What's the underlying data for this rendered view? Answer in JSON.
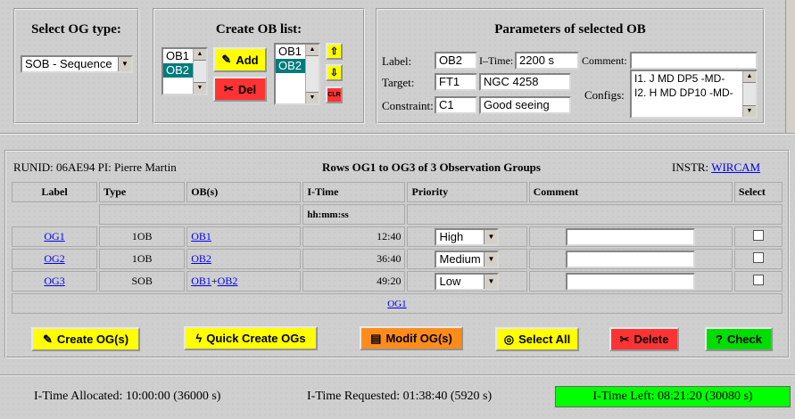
{
  "og_type": {
    "title": "Select OG type:",
    "selected": "SOB - Sequence"
  },
  "ob_list": {
    "title": "Create OB list:",
    "left_items": [
      "OB1",
      "OB2"
    ],
    "right_items": [
      "OB1",
      "OB2"
    ],
    "add_label": "Add",
    "del_label": "Del",
    "clr_label": "CLR"
  },
  "params": {
    "title": "Parameters of selected OB",
    "label_lbl": "Label:",
    "label_val": "OB2",
    "itime_lbl": "I–Time:",
    "itime_val": "2200 s",
    "comment_lbl": "Comment:",
    "comment_val": "",
    "target_lbl": "Target:",
    "target_val": "FT1",
    "target_name": "NGC 4258",
    "configs_lbl": "Configs:",
    "configs": [
      "I1. J MD DP5 -MD-",
      "I2. H MD DP10 -MD-"
    ],
    "constraint_lbl": "Constraint:",
    "constraint_val": "C1",
    "constraint_desc": "Good seeing"
  },
  "og_table": {
    "runid": "RUNID: 06AE94 PI: Pierre Martin",
    "rows_title": "Rows OG1 to OG3 of 3 Observation Groups",
    "instr_label": "INSTR:",
    "instr_link": "WIRCAM",
    "headers": [
      "Label",
      "Type",
      "OB(s)",
      "I-Time",
      "Priority",
      "Comment",
      "Select"
    ],
    "itime_unit": "hh:mm:ss",
    "rows": [
      {
        "label": "OG1",
        "type": "1OB",
        "obs": [
          "OB1"
        ],
        "itime": "12:40",
        "priority": "High",
        "comment": ""
      },
      {
        "label": "OG2",
        "type": "1OB",
        "obs": [
          "OB2"
        ],
        "itime": "36:40",
        "priority": "Medium",
        "comment": ""
      },
      {
        "label": "OG3",
        "type": "SOB",
        "obs": [
          "OB1",
          "OB2"
        ],
        "itime": "49:20",
        "priority": "Low",
        "comment": ""
      }
    ],
    "page_link": "OG1"
  },
  "actions": {
    "create": "Create OG(s)",
    "quick": "Quick Create OGs",
    "modif": "Modif OG(s)",
    "select_all": "Select All",
    "delete": "Delete",
    "check": "Check"
  },
  "status": {
    "allocated": "I-Time Allocated: 10:00:00 (36000 s)",
    "requested": "I-Time Requested: 01:38:40 (5920 s)",
    "left": "I-Time Left: 08:21:20 (30080 s)"
  },
  "colors": {
    "yellow_btn": "#ffff00",
    "red_btn": "#ff3333",
    "orange_btn": "#ff8c1a",
    "green_btn": "#00dd00",
    "selected_teal": "#007b7b",
    "time_left_bg": "#00ff00"
  }
}
